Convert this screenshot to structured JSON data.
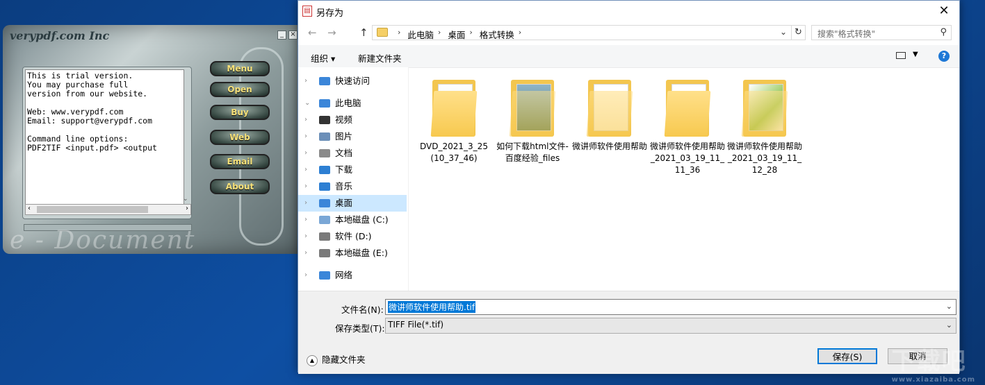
{
  "bg_app": {
    "brand": "verypdf.com Inc",
    "minimize": "_",
    "close": "×",
    "text_lines": "This is trial version.\nYou may purchase full\nversion from our website.\n\nWeb: www.verypdf.com\nEmail: support@verypdf.com\n\nCommand line options:\nPDF2TIF <input.pdf> <output",
    "buttons": [
      "Menu",
      "Open",
      "Buy",
      "Web",
      "Email",
      "About"
    ],
    "watermark": "e - Document"
  },
  "dialog": {
    "title": "另存为",
    "close": "✕",
    "nav": {
      "back": "←",
      "forward": "→",
      "up": "↑"
    },
    "breadcrumb": [
      "此电脑",
      "桌面",
      "格式转换"
    ],
    "search_placeholder": "搜索\"格式转换\"",
    "toolbar": {
      "organize": "组织 ▾",
      "new_folder": "新建文件夹",
      "help": "?"
    },
    "sidebar": [
      {
        "label": "快速访问",
        "icon": "star-icon",
        "color": "#3b86d9"
      },
      {
        "label": "此电脑",
        "icon": "computer-icon",
        "color": "#3b86d9"
      },
      {
        "label": "视频",
        "icon": "video-icon",
        "color": "#333333"
      },
      {
        "label": "图片",
        "icon": "picture-icon",
        "color": "#6b8fb8"
      },
      {
        "label": "文档",
        "icon": "document-icon",
        "color": "#8a8a8a"
      },
      {
        "label": "下载",
        "icon": "download-icon",
        "color": "#2d7fd3"
      },
      {
        "label": "音乐",
        "icon": "music-icon",
        "color": "#2d7fd3"
      },
      {
        "label": "桌面",
        "icon": "desktop-icon",
        "color": "#3b86d9"
      },
      {
        "label": "本地磁盘 (C:)",
        "icon": "drive-icon",
        "color": "#7aa7d6"
      },
      {
        "label": "软件 (D:)",
        "icon": "drive-icon",
        "color": "#7a7a7a"
      },
      {
        "label": "本地磁盘 (E:)",
        "icon": "drive-icon",
        "color": "#7a7a7a"
      },
      {
        "label": "网络",
        "icon": "network-icon",
        "color": "#3b86d9"
      }
    ],
    "folders": [
      "DVD_2021_3_25 (10_37_46)",
      "如何下载html文件-百度经验_files",
      "微讲师软件使用帮助",
      "微讲师软件使用帮助_2021_03_19_11_11_36",
      "微讲师软件使用帮助_2021_03_19_11_12_28"
    ],
    "filename_label": "文件名(N):",
    "filename_value": "微讲师软件使用帮助.tif",
    "filetype_label": "保存类型(T):",
    "filetype_value": "TIFF File(*.tif)",
    "hide_folders": "隐藏文件夹",
    "save": "保存(S)",
    "cancel": "取消"
  },
  "watermark_logo": {
    "text": "下载吧",
    "url": "www.xiazaiba.com"
  }
}
